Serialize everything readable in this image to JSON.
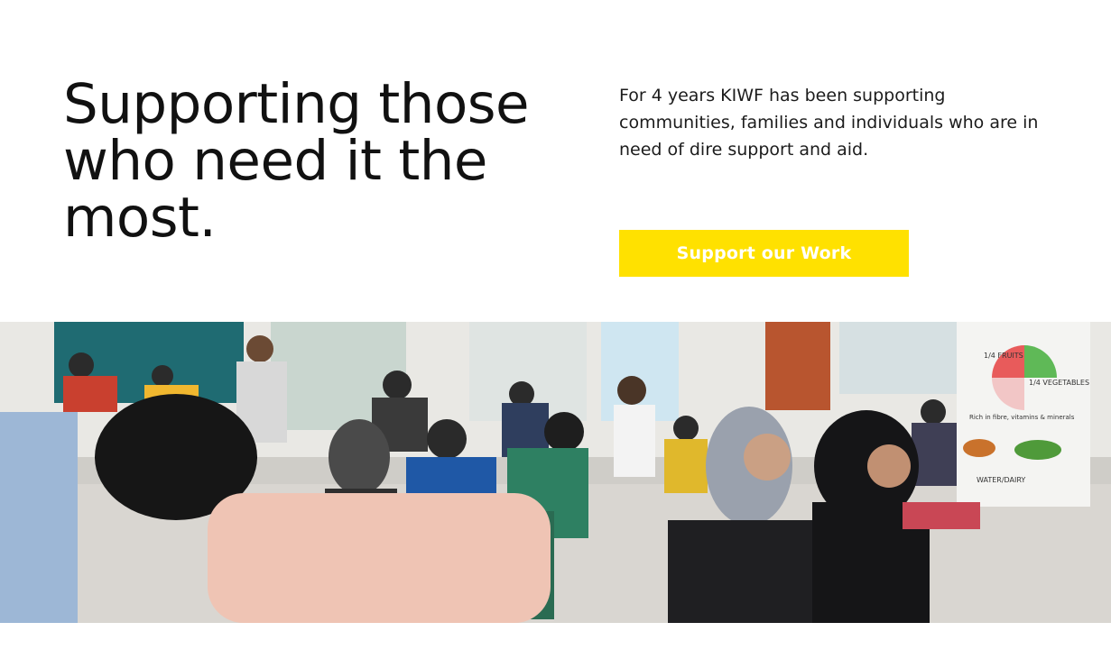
{
  "hero": {
    "headline": "Supporting those who need it the most.",
    "intro": "For 4 years KIWF has been supporting communities, families and individuals who are in need of dire support and aid.",
    "cta_label": "Support our Work",
    "cta_color": "#ffe100"
  },
  "photo": {
    "subject": "children-sitting-on-floor-learning-activity",
    "poster": {
      "fruits_label": "1/4 FRUITS",
      "vegetables_label": "1/4 VEGETABLES",
      "caption": "Rich in fibre, vitamins & minerals",
      "footer": "WATER/DAIRY"
    }
  }
}
